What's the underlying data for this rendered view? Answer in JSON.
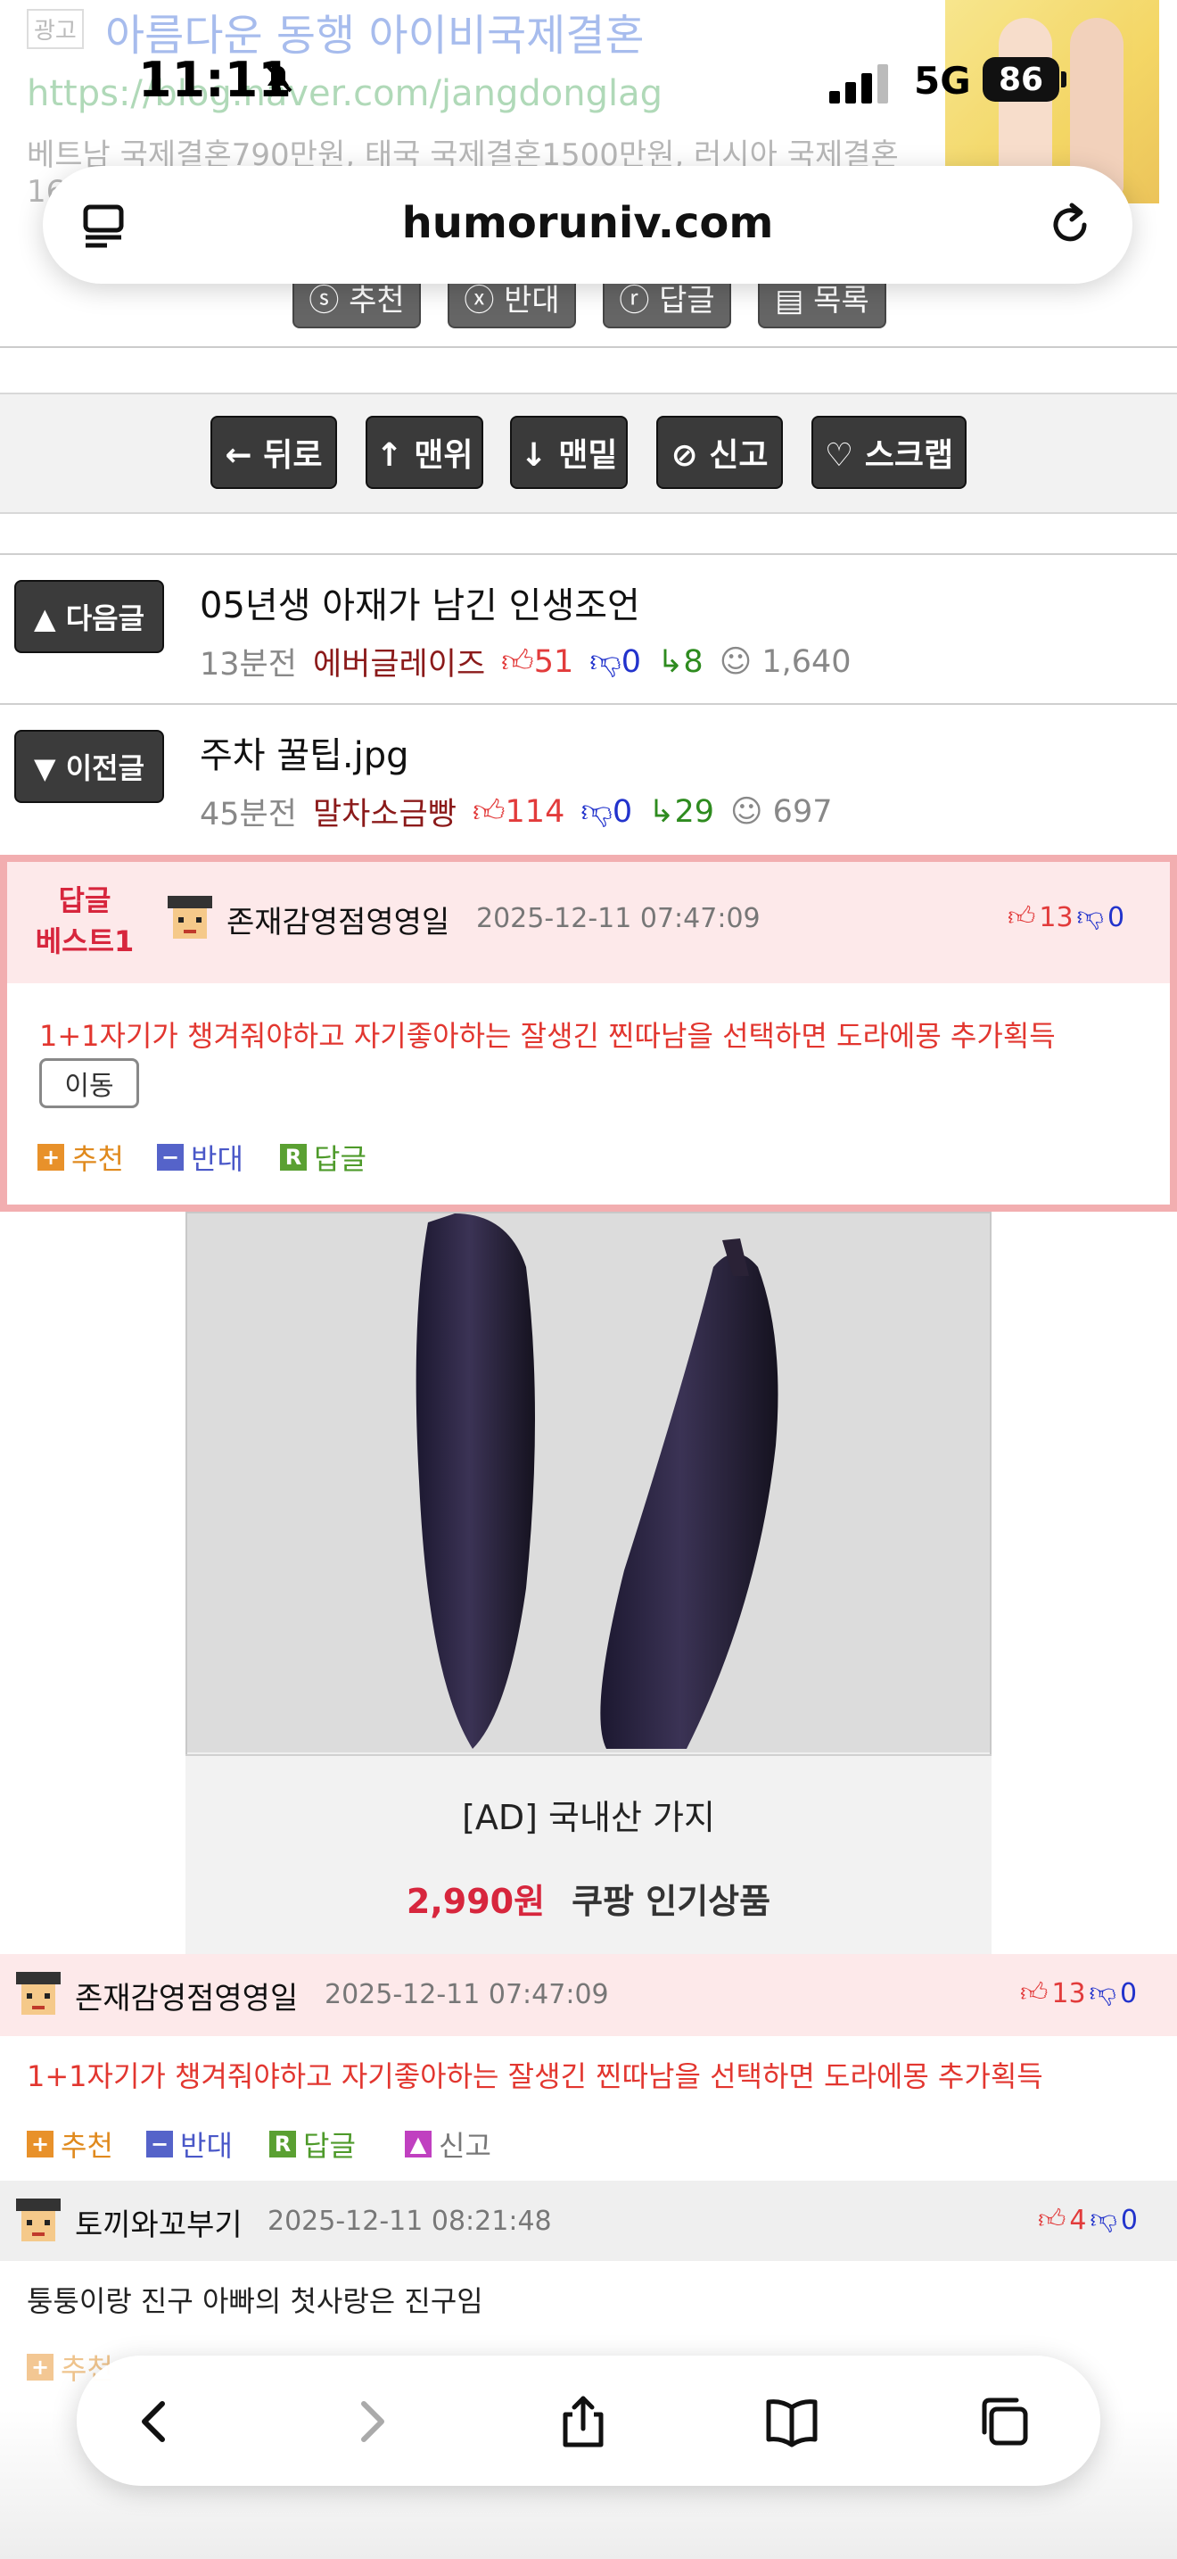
{
  "ad": {
    "badge": "광고",
    "title": "아름다운 동행 아이비국제결혼",
    "url_visible": "https://blog.naver.com/jangdonglag",
    "desc": "베트남 국제결혼790만원, 태국 국제결혼1500만원, 러시아 국제결혼 16"
  },
  "status": {
    "time": "11:11",
    "network": "5G",
    "battery": "86"
  },
  "browser": {
    "url": "humoruniv.com"
  },
  "faded_buttons": [
    "ⓢ 추천",
    "ⓧ 반대",
    "ⓡ 답글",
    "▤ 목록"
  ],
  "nav_buttons": [
    "← 뒤로",
    "↑ 맨위",
    "↓ 맨밑",
    "⊘ 신고",
    "♡ 스크랩"
  ],
  "next_post": {
    "button": "▲ 다음글",
    "title": "05년생 아재가 남긴 인생조언",
    "time": "13분전",
    "author": "에버글레이즈",
    "up": "51",
    "down": "0",
    "replies": "8",
    "views": "1,640"
  },
  "prev_post": {
    "button": "▼ 이전글",
    "title": "주차 꿀팁.jpg",
    "time": "45분전",
    "author": "말차소금빵",
    "up": "114",
    "down": "0",
    "replies": "29",
    "views": "697"
  },
  "best_reply": {
    "label_line1": "답글",
    "label_line2": "베스트1",
    "user": "존재감영점영영일",
    "date": "2025-12-11 07:47:09",
    "up": "13",
    "down": "0",
    "text": "1+1자기가 챙겨줘야하고 자기좋아하는 잘생긴 찐따남을 선택하면 도라에몽 추가획득",
    "move": "이동",
    "actions": {
      "recommend": "추천",
      "oppose": "반대",
      "reply": "답글"
    }
  },
  "product_ad": {
    "title": "[AD] 국내산 가지",
    "price": "2,990원",
    "tag": "쿠팡 인기상품"
  },
  "comments": [
    {
      "user": "존재감영점영영일",
      "date": "2025-12-11 07:47:09",
      "up": "13",
      "down": "0",
      "text": "1+1자기가 챙겨줘야하고 자기좋아하는 잘생긴 찐따남을 선택하면 도라에몽 추가획득",
      "actions": {
        "recommend": "추천",
        "oppose": "반대",
        "reply": "답글",
        "report": "신고"
      }
    },
    {
      "user": "토끼와꼬부기",
      "date": "2025-12-11 08:21:48",
      "up": "4",
      "down": "0",
      "text": "퉁퉁이랑 진구 아빠의 첫사랑은 진구임",
      "actions": {
        "recommend": "추천"
      }
    }
  ],
  "colors": {
    "accent_red": "#e23b3b",
    "down_blue": "#2233cc",
    "reply_green": "#2e8b1f",
    "best_border": "#f2aeb0"
  }
}
